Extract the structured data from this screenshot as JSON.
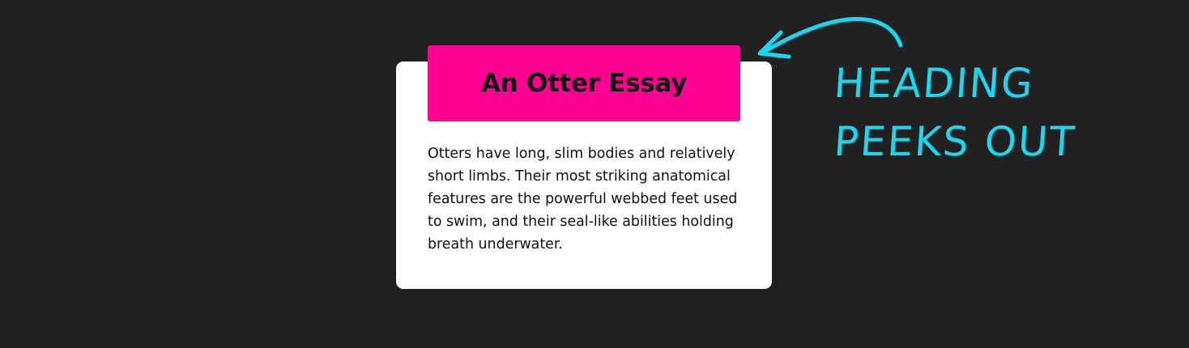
{
  "essay": {
    "heading": "An Otter Essay",
    "body": "Otters have long, slim bodies and relatively short limbs. Their most striking anatomical features are the powerful webbed feet used to swim, and their seal-like abilities holding breath underwater."
  },
  "annotation": {
    "line1": "HEADING",
    "line2": "PEEKS OUT",
    "icon": "hand-drawn-arrow-icon"
  },
  "colors": {
    "background": "#212121",
    "card": "#ffffff",
    "heading_bg": "#ff0090",
    "annotation": "#19d7f0"
  }
}
